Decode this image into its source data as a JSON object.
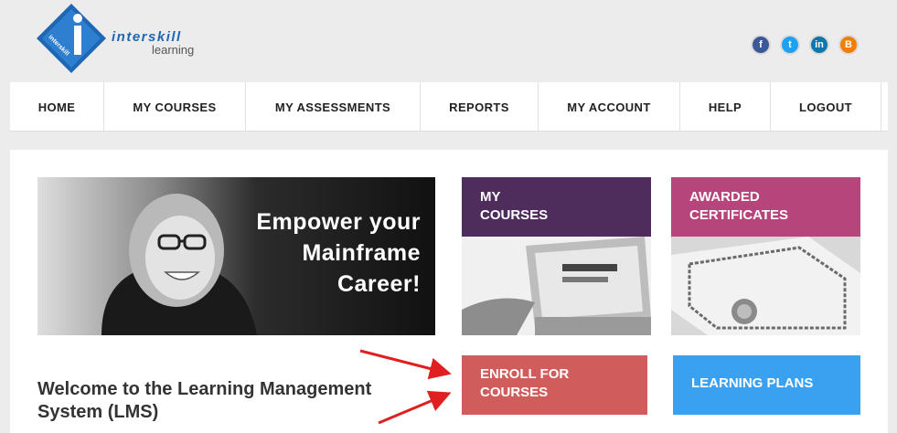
{
  "logo": {
    "brand": "interskill",
    "sub": "learning",
    "mark_text": "interskill"
  },
  "social": [
    {
      "name": "facebook-icon",
      "glyph": "f",
      "color": "#3b5998"
    },
    {
      "name": "twitter-icon",
      "glyph": "t",
      "color": "#1da1f2"
    },
    {
      "name": "linkedin-icon",
      "glyph": "in",
      "color": "#0e76a8"
    },
    {
      "name": "blogger-icon",
      "glyph": "B",
      "color": "#f57d00"
    }
  ],
  "nav": {
    "home": "HOME",
    "my_courses": "MY COURSES",
    "my_assessments": "MY ASSESSMENTS",
    "reports": "REPORTS",
    "my_account": "MY ACCOUNT",
    "help": "HELP",
    "logout": "LOGOUT"
  },
  "hero": {
    "line1": "Empower your",
    "line2": "Mainframe",
    "line3": "Career!"
  },
  "tiles": {
    "my_courses": {
      "line1": "MY",
      "line2": "COURSES",
      "color": "#4e2d5c"
    },
    "awarded_certificates": {
      "line1": "AWARDED",
      "line2": "CERTIFICATES",
      "color": "#b5457a"
    },
    "enroll": {
      "line1": "ENROLL FOR",
      "line2": "COURSES",
      "color": "#d15c5c"
    },
    "learning_plans": {
      "line1": "LEARNING PLANS",
      "color": "#3aa1f0"
    }
  },
  "welcome": {
    "line1": "Welcome to the Learning Management",
    "line2": "System (LMS)"
  }
}
